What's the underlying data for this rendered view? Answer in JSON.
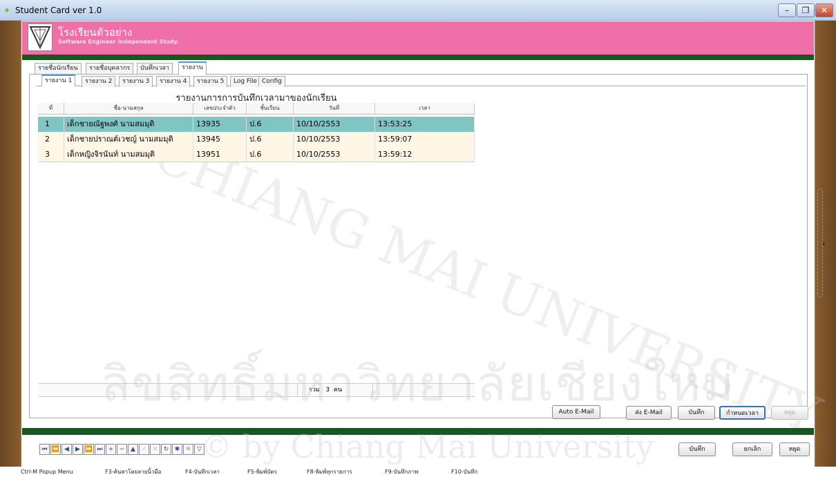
{
  "window": {
    "title": "Student Card ver 1.0",
    "min_label": "–",
    "max_label": "❐",
    "close_label": "✕"
  },
  "banner": {
    "school_name": "โรงเรียนตัวอย่าง",
    "subtitle": "Software Engineer Independent Study."
  },
  "outer_tabs": [
    "รายชื่อนักเรียน",
    "รายชื่อบุคลากร",
    "บันทึกเวลา",
    "รายงาน"
  ],
  "inner_tabs": [
    "รายงาน 1",
    "รายงาน 2",
    "รายงาน 3",
    "รายงาน 4",
    "รายงาน 5",
    "Log File",
    "Config"
  ],
  "report": {
    "title": "รายงานการการบันทึกเวลามาของนักเรียน",
    "columns": [
      "ที่",
      "ชื่อ-นามสกุล",
      "เลขประจำตัว",
      "ชั้นเรียน",
      "วันที่",
      "เวลา"
    ],
    "rows": [
      [
        "1",
        "เด็กชายณัฐพงศ์ นามสมมุติ",
        "13935",
        "ป.6",
        "10/10/2553",
        "13:53:25"
      ],
      [
        "2",
        "เด็กชายปราณต์เวชญ์ นามสมมุติ",
        "13945",
        "ป.6",
        "10/10/2553",
        "13:59:07"
      ],
      [
        "3",
        "เด็กหญิงจิรนันท์ นามสมมุติ",
        "13951",
        "ป.6",
        "10/10/2553",
        "13:59:12"
      ]
    ],
    "total_label": "รวม",
    "total_count": "3",
    "total_unit": "คน"
  },
  "actions": {
    "auto_email": "Auto E-Mail",
    "send_email": "ส่ง E-Mail",
    "save": "บันทึก",
    "set_time": "กำหนดเวลา",
    "stop": "หยุด"
  },
  "bottom_actions": {
    "save": "บันทึก",
    "cancel": "ยกเลิก",
    "stop": "หยุด"
  },
  "navigator": [
    "⏮",
    "⏪",
    "◀",
    "▶",
    "⏩",
    "⏭",
    "+",
    "−",
    "▲",
    "✓",
    "✕",
    "↻",
    "✱",
    "✱",
    "▽"
  ],
  "statusbar": [
    "Ctrl-M  Popup Menu",
    "F3-ค้นหาโดยลายนิ้วมือ",
    "F4-บันทึกเวลา",
    "F5-พิมพ์บัตร",
    "F8-พิมพ์ทุกรายการ",
    "F9-บันทึกภาพ",
    "F10-บันทึก"
  ],
  "watermark": {
    "line1": "ลิขสิทธิ์มหาวิทยาลัยเชียงใหม่",
    "line2": "CHIANG MAI UNIVERSITY",
    "line3": "© by Chiang Mai University"
  },
  "colors": {
    "banner": "#f06fa8",
    "selected_row": "#7fc5c3",
    "even_row": "#fff6e6",
    "green_bar": "#18571f"
  }
}
